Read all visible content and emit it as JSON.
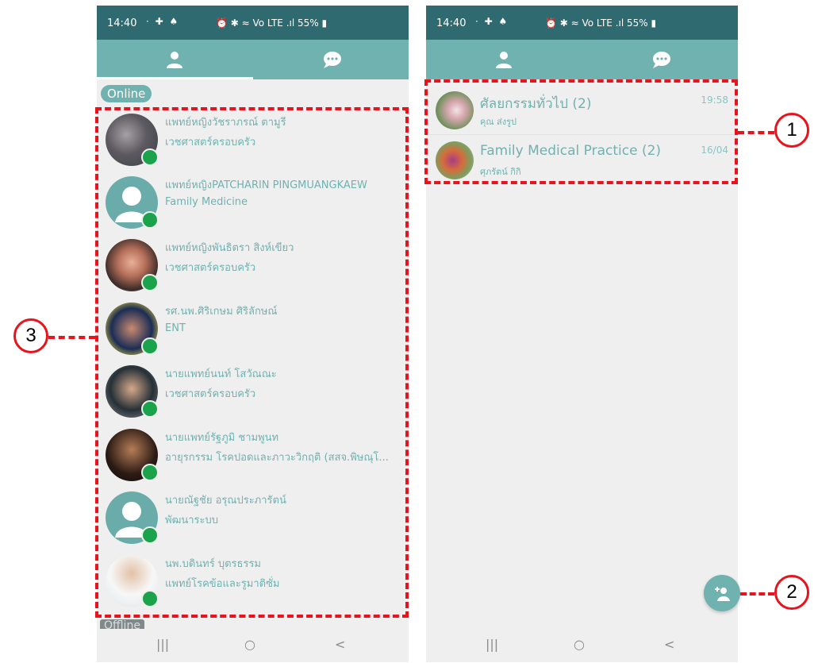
{
  "left_screen": {
    "status_bar": {
      "time": "14:40",
      "notif_icons": "⋅ ✚ ♠",
      "system": "⏰ ✱ ≈ Vo LTE .ıl 55% ▮"
    },
    "section_online": "Online",
    "section_offline": "Offline",
    "contacts": [
      {
        "name": "แพทย์หญิงวัชราภรณ์ ตามูรี",
        "dept": "เวชศาสตร์ครอบครัว"
      },
      {
        "name": "แพทย์หญิงPATCHARIN PINGMUANGKAEW",
        "dept": "Family Medicine"
      },
      {
        "name": "แพทย์หญิงพันธิตรา สิงห์เขียว",
        "dept": "เวชศาสตร์ครอบครัว"
      },
      {
        "name": "รศ.นพ.ศิริเกษม ศิริลักษณ์",
        "dept": " ENT"
      },
      {
        "name": "นายแพทย์นนท์ โสวัณณะ",
        "dept": "เวชศาสตร์ครอบครัว"
      },
      {
        "name": "นายแพทย์รัฐภูมิ  ชามพูนท",
        "dept": "อายุรกรรม โรคปอดและภาวะวิกฤติ (สสจ.พิษณุโ..."
      },
      {
        "name": "นายณัฐชัย อรุณประภารัตน์",
        "dept": "พัฒนาระบบ"
      },
      {
        "name": "นพ.บดินทร์ บุตรธรรม",
        "dept": "แพทย์โรคข้อและรูมาติซั่ม"
      }
    ]
  },
  "right_screen": {
    "status_bar": {
      "time": "14:40",
      "notif_icons": "⋅ ✚ ♠",
      "system": "⏰ ✱ ≈ Vo LTE .ıl 55% ▮"
    },
    "chats": [
      {
        "title": "ศัลยกรรมทั่วไป (2)",
        "time": "19:58",
        "sender": "คุณ ส่งรูป"
      },
      {
        "title": " Family Medical Practice (2)",
        "time": "16/04",
        "sender": "ศุภรัตน์ กิกิ"
      }
    ]
  },
  "nav": {
    "recents": "|||",
    "home": "○",
    "back": "<"
  },
  "callouts": {
    "c1": "1",
    "c2": "2",
    "c3": "3"
  },
  "colors": {
    "status_bar": "#2f6a71",
    "teal": "#6fb2b0",
    "online_dot": "#1aa34a",
    "callout_red": "#e8131d"
  },
  "icons": {
    "tab_contacts": "person-icon",
    "tab_chats": "chat-bubbles-icon",
    "fab": "add-group-icon"
  }
}
